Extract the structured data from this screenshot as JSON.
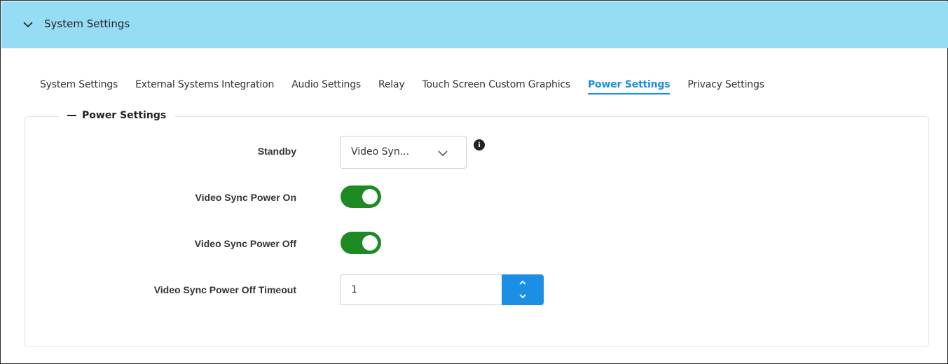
{
  "header": {
    "title": "System Settings",
    "icon": "chevron-down-icon"
  },
  "tabs": [
    {
      "label": "System Settings",
      "active": false
    },
    {
      "label": "External Systems Integration",
      "active": false
    },
    {
      "label": "Audio Settings",
      "active": false
    },
    {
      "label": "Relay",
      "active": false
    },
    {
      "label": "Touch Screen Custom Graphics",
      "active": false
    },
    {
      "label": "Power Settings",
      "active": true
    },
    {
      "label": "Privacy Settings",
      "active": false
    }
  ],
  "section": {
    "legend": "Power Settings",
    "standby": {
      "label": "Standby",
      "value": "Video Syn...",
      "info_icon": "info-icon"
    },
    "video_sync_power_on": {
      "label": "Video Sync Power On",
      "enabled": true
    },
    "video_sync_power_off": {
      "label": "Video Sync Power Off",
      "enabled": true
    },
    "timeout": {
      "label": "Video Sync Power Off Timeout",
      "value": "1"
    }
  },
  "colors": {
    "header_bg": "#97dcf5",
    "accent": "#1a8fe3",
    "toggle_on": "#1d8a24"
  }
}
